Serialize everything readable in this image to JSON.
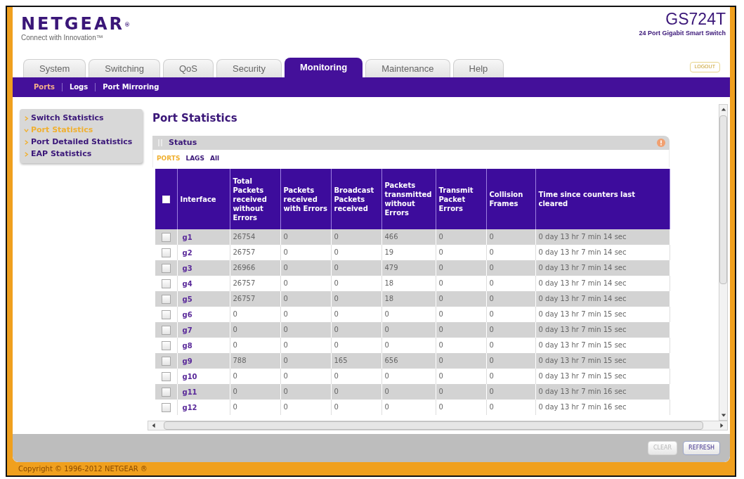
{
  "header": {
    "logo": "NETGEAR$^{®}$",
    "tagline": "Connect with Innovation™",
    "model": "GS724T",
    "description": "24 Port Gigabit Smart Switch"
  },
  "tabs": [
    {
      "label": "System",
      "selected": false
    },
    {
      "label": "Switching",
      "selected": false
    },
    {
      "label": "QoS",
      "selected": false
    },
    {
      "label": "Security",
      "selected": false
    },
    {
      "label": "Monitoring",
      "selected": true
    },
    {
      "label": "Maintenance",
      "selected": false
    },
    {
      "label": "Help",
      "selected": false
    }
  ],
  "logout_button": "LOGOUT",
  "subnav": [
    {
      "label": "Ports",
      "selected": true
    },
    {
      "label": "Logs",
      "selected": false
    },
    {
      "label": "Port Mirroring",
      "selected": false
    }
  ],
  "sidebar": {
    "items": [
      {
        "label": "Switch Statistics",
        "selected": false
      },
      {
        "label": "Port Statistics",
        "selected": true
      },
      {
        "label": "Port Detailed Statistics",
        "selected": false
      },
      {
        "label": "EAP Statistics",
        "selected": false
      }
    ]
  },
  "page_title": "Port Statistics",
  "status_panel": {
    "title": "Status",
    "filters": [
      {
        "label": "PORTS",
        "selected": true
      },
      {
        "label": "LAGS",
        "selected": false
      },
      {
        "label": "All",
        "selected": false
      }
    ],
    "table": {
      "select_all_checked": false,
      "columns": [
        "Interface",
        "Total Packets received without Errors",
        "Packets received with Errors",
        "Broadcast Packets received",
        "Packets transmitted without Errors",
        "Transmit Packet Errors",
        "Collision Frames",
        "Time since counters last cleared"
      ],
      "rows": [
        {
          "checked": false,
          "interface": "g1",
          "values": [
            "26754",
            "0",
            "0",
            "466",
            "0",
            "0",
            "0 day 13 hr 7 min 14 sec"
          ]
        },
        {
          "checked": false,
          "interface": "g2",
          "values": [
            "26757",
            "0",
            "0",
            "19",
            "0",
            "0",
            "0 day 13 hr 7 min 14 sec"
          ]
        },
        {
          "checked": false,
          "interface": "g3",
          "values": [
            "26966",
            "0",
            "0",
            "479",
            "0",
            "0",
            "0 day 13 hr 7 min 14 sec"
          ]
        },
        {
          "checked": false,
          "interface": "g4",
          "values": [
            "26757",
            "0",
            "0",
            "18",
            "0",
            "0",
            "0 day 13 hr 7 min 14 sec"
          ]
        },
        {
          "checked": false,
          "interface": "g5",
          "values": [
            "26757",
            "0",
            "0",
            "18",
            "0",
            "0",
            "0 day 13 hr 7 min 14 sec"
          ]
        },
        {
          "checked": false,
          "interface": "g6",
          "values": [
            "0",
            "0",
            "0",
            "0",
            "0",
            "0",
            "0 day 13 hr 7 min 15 sec"
          ]
        },
        {
          "checked": false,
          "interface": "g7",
          "values": [
            "0",
            "0",
            "0",
            "0",
            "0",
            "0",
            "0 day 13 hr 7 min 15 sec"
          ]
        },
        {
          "checked": false,
          "interface": "g8",
          "values": [
            "0",
            "0",
            "0",
            "0",
            "0",
            "0",
            "0 day 13 hr 7 min 15 sec"
          ]
        },
        {
          "checked": false,
          "interface": "g9",
          "values": [
            "788",
            "0",
            "165",
            "656",
            "0",
            "0",
            "0 day 13 hr 7 min 15 sec"
          ]
        },
        {
          "checked": false,
          "interface": "g10",
          "values": [
            "0",
            "0",
            "0",
            "0",
            "0",
            "0",
            "0 day 13 hr 7 min 15 sec"
          ]
        },
        {
          "checked": false,
          "interface": "g11",
          "values": [
            "0",
            "0",
            "0",
            "0",
            "0",
            "0",
            "0 day 13 hr 7 min 16 sec"
          ]
        },
        {
          "checked": false,
          "interface": "g12",
          "values": [
            "0",
            "0",
            "0",
            "0",
            "0",
            "0",
            "0 day 13 hr 7 min 16 sec"
          ]
        }
      ]
    }
  },
  "buttons": [
    {
      "label": "CLEAR",
      "disabled": true
    },
    {
      "label": "REFRESH",
      "disabled": false
    }
  ],
  "footer": "Copyright © 1996-2012 NETGEAR ®"
}
